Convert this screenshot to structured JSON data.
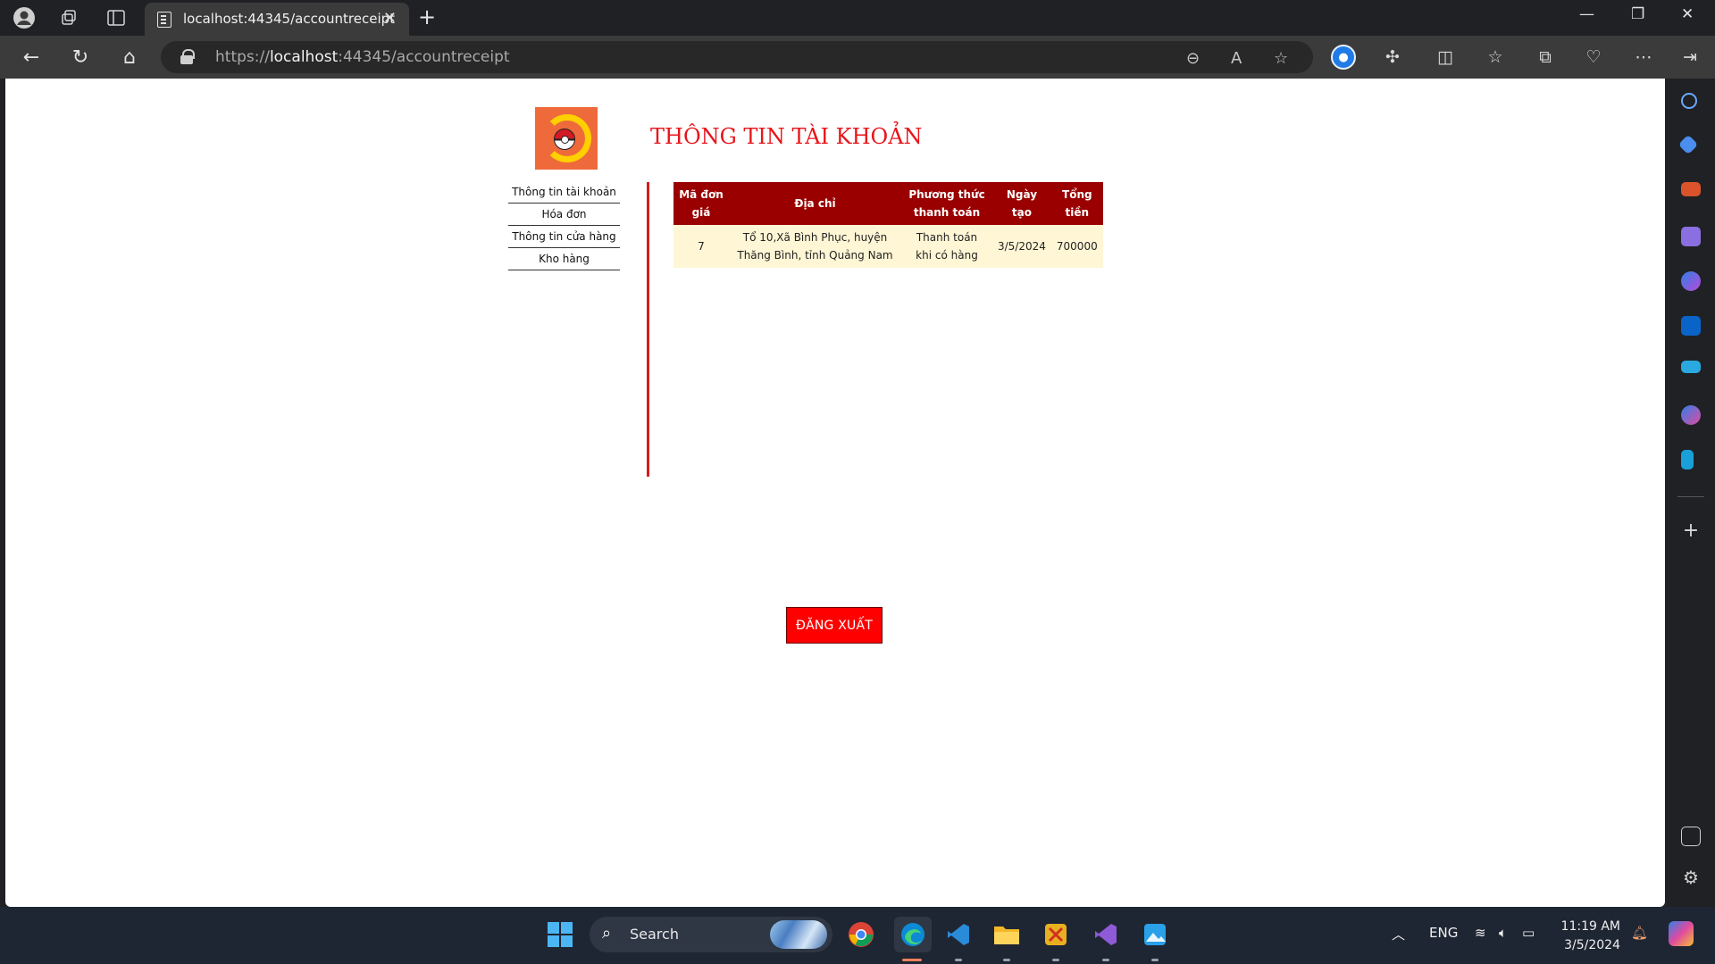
{
  "browser": {
    "tab_title": "localhost:44345/accountreceipt",
    "url_scheme": "https://",
    "url_host": "localhost",
    "url_rest": ":44345/accountreceipt"
  },
  "page": {
    "title": "THÔNG TIN TÀI KHOẢN",
    "menu": [
      {
        "label": "Thông tin tài khoản"
      },
      {
        "label": "Hóa đơn"
      },
      {
        "label": "Thông tin cửa hàng"
      },
      {
        "label": "Kho hàng"
      }
    ],
    "table": {
      "headers": [
        "Mã đơn giá",
        "Địa chỉ",
        "Phương thức thanh toán",
        "Ngày tạo",
        "Tổng tiền"
      ],
      "rows": [
        [
          "7",
          "Tổ 10,Xã Bình Phục, huyện Thăng Bình, tỉnh Quảng Nam",
          "Thanh toán khi có hàng",
          "3/5/2024",
          "700000"
        ]
      ]
    },
    "logout_label": "ĐĂNG XUẤT"
  },
  "taskbar": {
    "search_label": "Search",
    "lang": "ENG",
    "time": "11:19 AM",
    "date": "3/5/2024"
  },
  "colors": {
    "accent_red": "#e8141a",
    "table_header": "#9a0000",
    "table_row": "#fff6d5",
    "logout_button": "#ff0000"
  }
}
